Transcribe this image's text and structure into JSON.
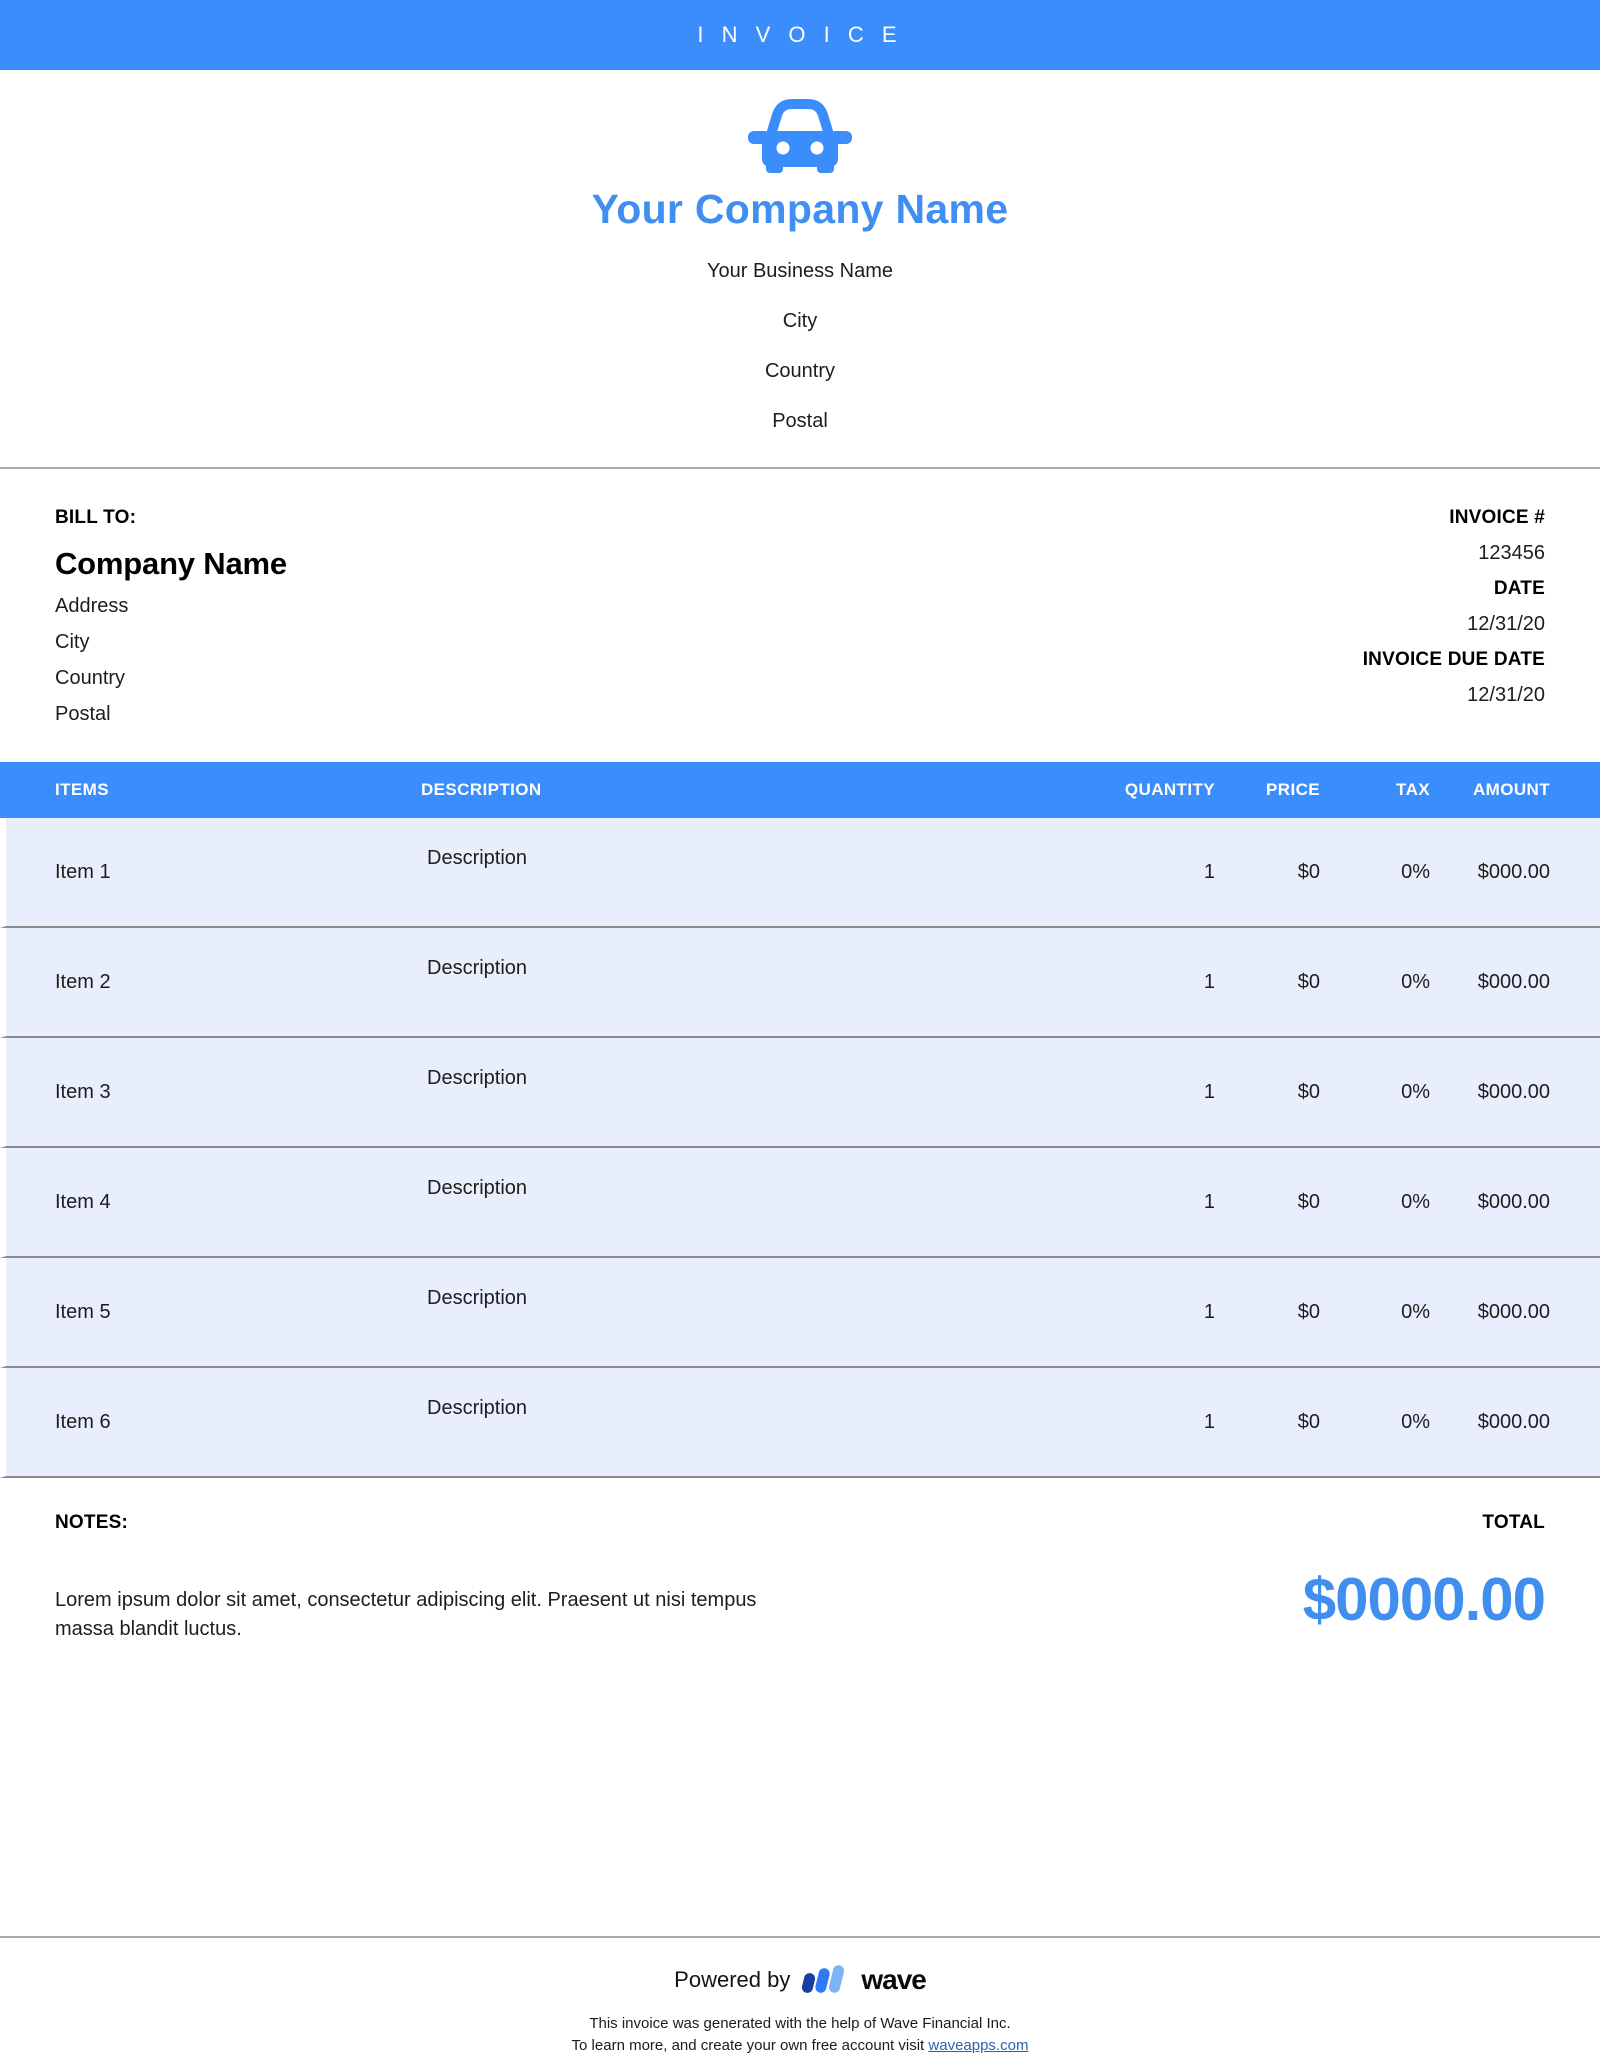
{
  "banner": {
    "title": "I N V O I C E"
  },
  "company": {
    "logo_icon": "car-icon",
    "name": "Your Company Name",
    "lines": [
      "Your Business Name",
      "City",
      "Country",
      "Postal"
    ]
  },
  "bill_to": {
    "label": "BILL TO:",
    "company": "Company Name",
    "lines": [
      "Address",
      "City",
      "Country",
      "Postal"
    ]
  },
  "invoice_meta": {
    "number_label": "INVOICE #",
    "number_value": "123456",
    "date_label": "DATE",
    "date_value": "12/31/20",
    "due_label": "INVOICE DUE DATE",
    "due_value": "12/31/20"
  },
  "table": {
    "headers": {
      "items": "ITEMS",
      "description": "DESCRIPTION",
      "quantity": "QUANTITY",
      "price": "PRICE",
      "tax": "TAX",
      "amount": "AMOUNT"
    },
    "rows": [
      {
        "item": "Item 1",
        "description": "Description",
        "quantity": "1",
        "price": "$0",
        "tax": "0%",
        "amount": "$000.00"
      },
      {
        "item": "Item 2",
        "description": "Description",
        "quantity": "1",
        "price": "$0",
        "tax": "0%",
        "amount": "$000.00"
      },
      {
        "item": "Item 3",
        "description": "Description",
        "quantity": "1",
        "price": "$0",
        "tax": "0%",
        "amount": "$000.00"
      },
      {
        "item": "Item 4",
        "description": "Description",
        "quantity": "1",
        "price": "$0",
        "tax": "0%",
        "amount": "$000.00"
      },
      {
        "item": "Item 5",
        "description": "Description",
        "quantity": "1",
        "price": "$0",
        "tax": "0%",
        "amount": "$000.00"
      },
      {
        "item": "Item 6",
        "description": "Description",
        "quantity": "1",
        "price": "$0",
        "tax": "0%",
        "amount": "$000.00"
      }
    ]
  },
  "notes": {
    "label": "NOTES:",
    "body": "Lorem ipsum dolor sit amet, consectetur adipiscing elit. Praesent ut nisi tempus massa blandit luctus."
  },
  "total": {
    "label": "TOTAL",
    "value": "$0000.00"
  },
  "footer": {
    "powered_by": "Powered by",
    "brand": "wave",
    "brand_icon": "wave-logo-icon",
    "note_line1": "This invoice was generated with the help of Wave Financial Inc.",
    "note_line2_prefix": "To learn more, and create your own free account visit ",
    "link_text": "waveapps.com"
  },
  "colors": {
    "accent_blue": "#3a8dfa",
    "heading_blue": "#3f8ef0",
    "row_bg": "#e8eefc",
    "divider_gray": "#8b8b8b",
    "link_blue": "#2c63b0",
    "wave_navy": "#1b3fa0",
    "wave_blue": "#2f7bf6",
    "wave_light": "#7db4f7"
  }
}
